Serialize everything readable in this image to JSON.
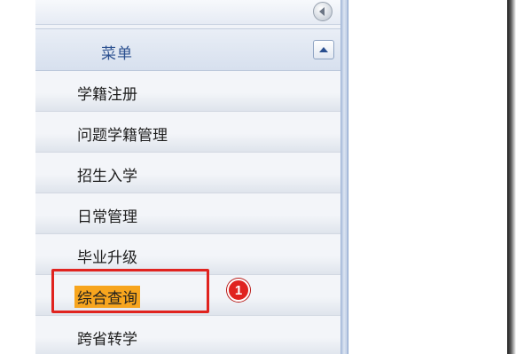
{
  "sidebar": {
    "title": "菜单",
    "items": [
      {
        "label": "学籍注册"
      },
      {
        "label": "问题学籍管理"
      },
      {
        "label": "招生入学"
      },
      {
        "label": "日常管理"
      },
      {
        "label": "毕业升级"
      },
      {
        "label": "综合查询",
        "highlighted": true
      },
      {
        "label": "跨省转学"
      }
    ]
  },
  "annotation": {
    "marker": "1",
    "color": "#e0231f"
  },
  "colors": {
    "highlight": "#f7a51e",
    "title": "#2a4f8f"
  },
  "icons": {
    "collapse": "collapse-left-icon",
    "toggle": "chevron-up-icon"
  }
}
